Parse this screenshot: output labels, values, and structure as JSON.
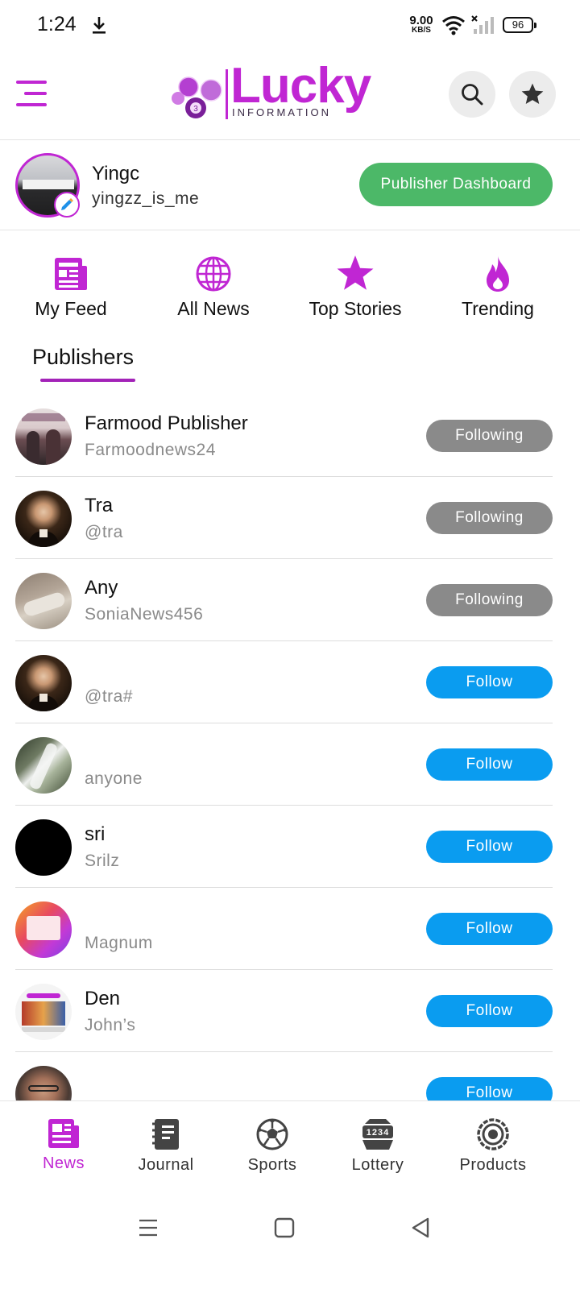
{
  "status_bar": {
    "time": "1:24",
    "net_speed_value": "9.00",
    "net_speed_unit": "KB/S",
    "battery": "96"
  },
  "app_bar": {
    "logo_word": "Lucky",
    "logo_sub": "INFORMATION",
    "logo_ball_number": "3",
    "brand_color": "#c026d3"
  },
  "profile": {
    "name": "Yingc",
    "handle": "yingzz_is_me",
    "dashboard_button": "Publisher Dashboard"
  },
  "categories": [
    {
      "label": "My Feed",
      "icon": "newspaper-icon"
    },
    {
      "label": "All News",
      "icon": "globe-icon"
    },
    {
      "label": "Top Stories",
      "icon": "star-icon"
    },
    {
      "label": "Trending",
      "icon": "flame-icon"
    }
  ],
  "tabs": {
    "active": "Publishers"
  },
  "publishers": [
    {
      "name": "Farmood Publisher",
      "handle": "Farmoodnews24",
      "button": "Following",
      "status": "following",
      "avatar": "two-people-photo"
    },
    {
      "name": "Tra",
      "handle": "@tra",
      "button": "Following",
      "status": "following",
      "avatar": "portrait-painting"
    },
    {
      "name": "Any",
      "handle": "SoniaNews456",
      "button": "Following",
      "status": "following",
      "avatar": "sculpture-photo"
    },
    {
      "name": "",
      "handle": "@tra#",
      "button": "Follow",
      "status": "follow",
      "avatar": "portrait-painting"
    },
    {
      "name": "",
      "handle": "anyone",
      "button": "Follow",
      "status": "follow",
      "avatar": "waterfall-photo"
    },
    {
      "name": "sri",
      "handle": "Srilz",
      "button": "Follow",
      "status": "follow",
      "avatar": "black-circle"
    },
    {
      "name": "",
      "handle": "Magnum",
      "button": "Follow",
      "status": "follow",
      "avatar": "gradient-screenshot"
    },
    {
      "name": "Den",
      "handle": "John’s",
      "button": "Follow",
      "status": "follow",
      "avatar": "app-screenshot"
    },
    {
      "name": "",
      "handle": "",
      "button": "Follow",
      "status": "follow",
      "avatar": "man-with-glasses"
    }
  ],
  "bottom_nav": [
    {
      "label": "News",
      "icon": "news-icon",
      "active": true
    },
    {
      "label": "Journal",
      "icon": "notebook-icon",
      "active": false
    },
    {
      "label": "Sports",
      "icon": "soccer-ball-icon",
      "active": false
    },
    {
      "label": "Lottery",
      "icon": "lottery-machine-icon",
      "active": false
    },
    {
      "label": "Products",
      "icon": "products-icon",
      "active": false
    }
  ],
  "lottery_icon_digits": "1234",
  "colors": {
    "accent": "#c026d3",
    "follow": "#0a9cf0",
    "following": "#8a8a8a",
    "dashboard": "#4cb868"
  }
}
